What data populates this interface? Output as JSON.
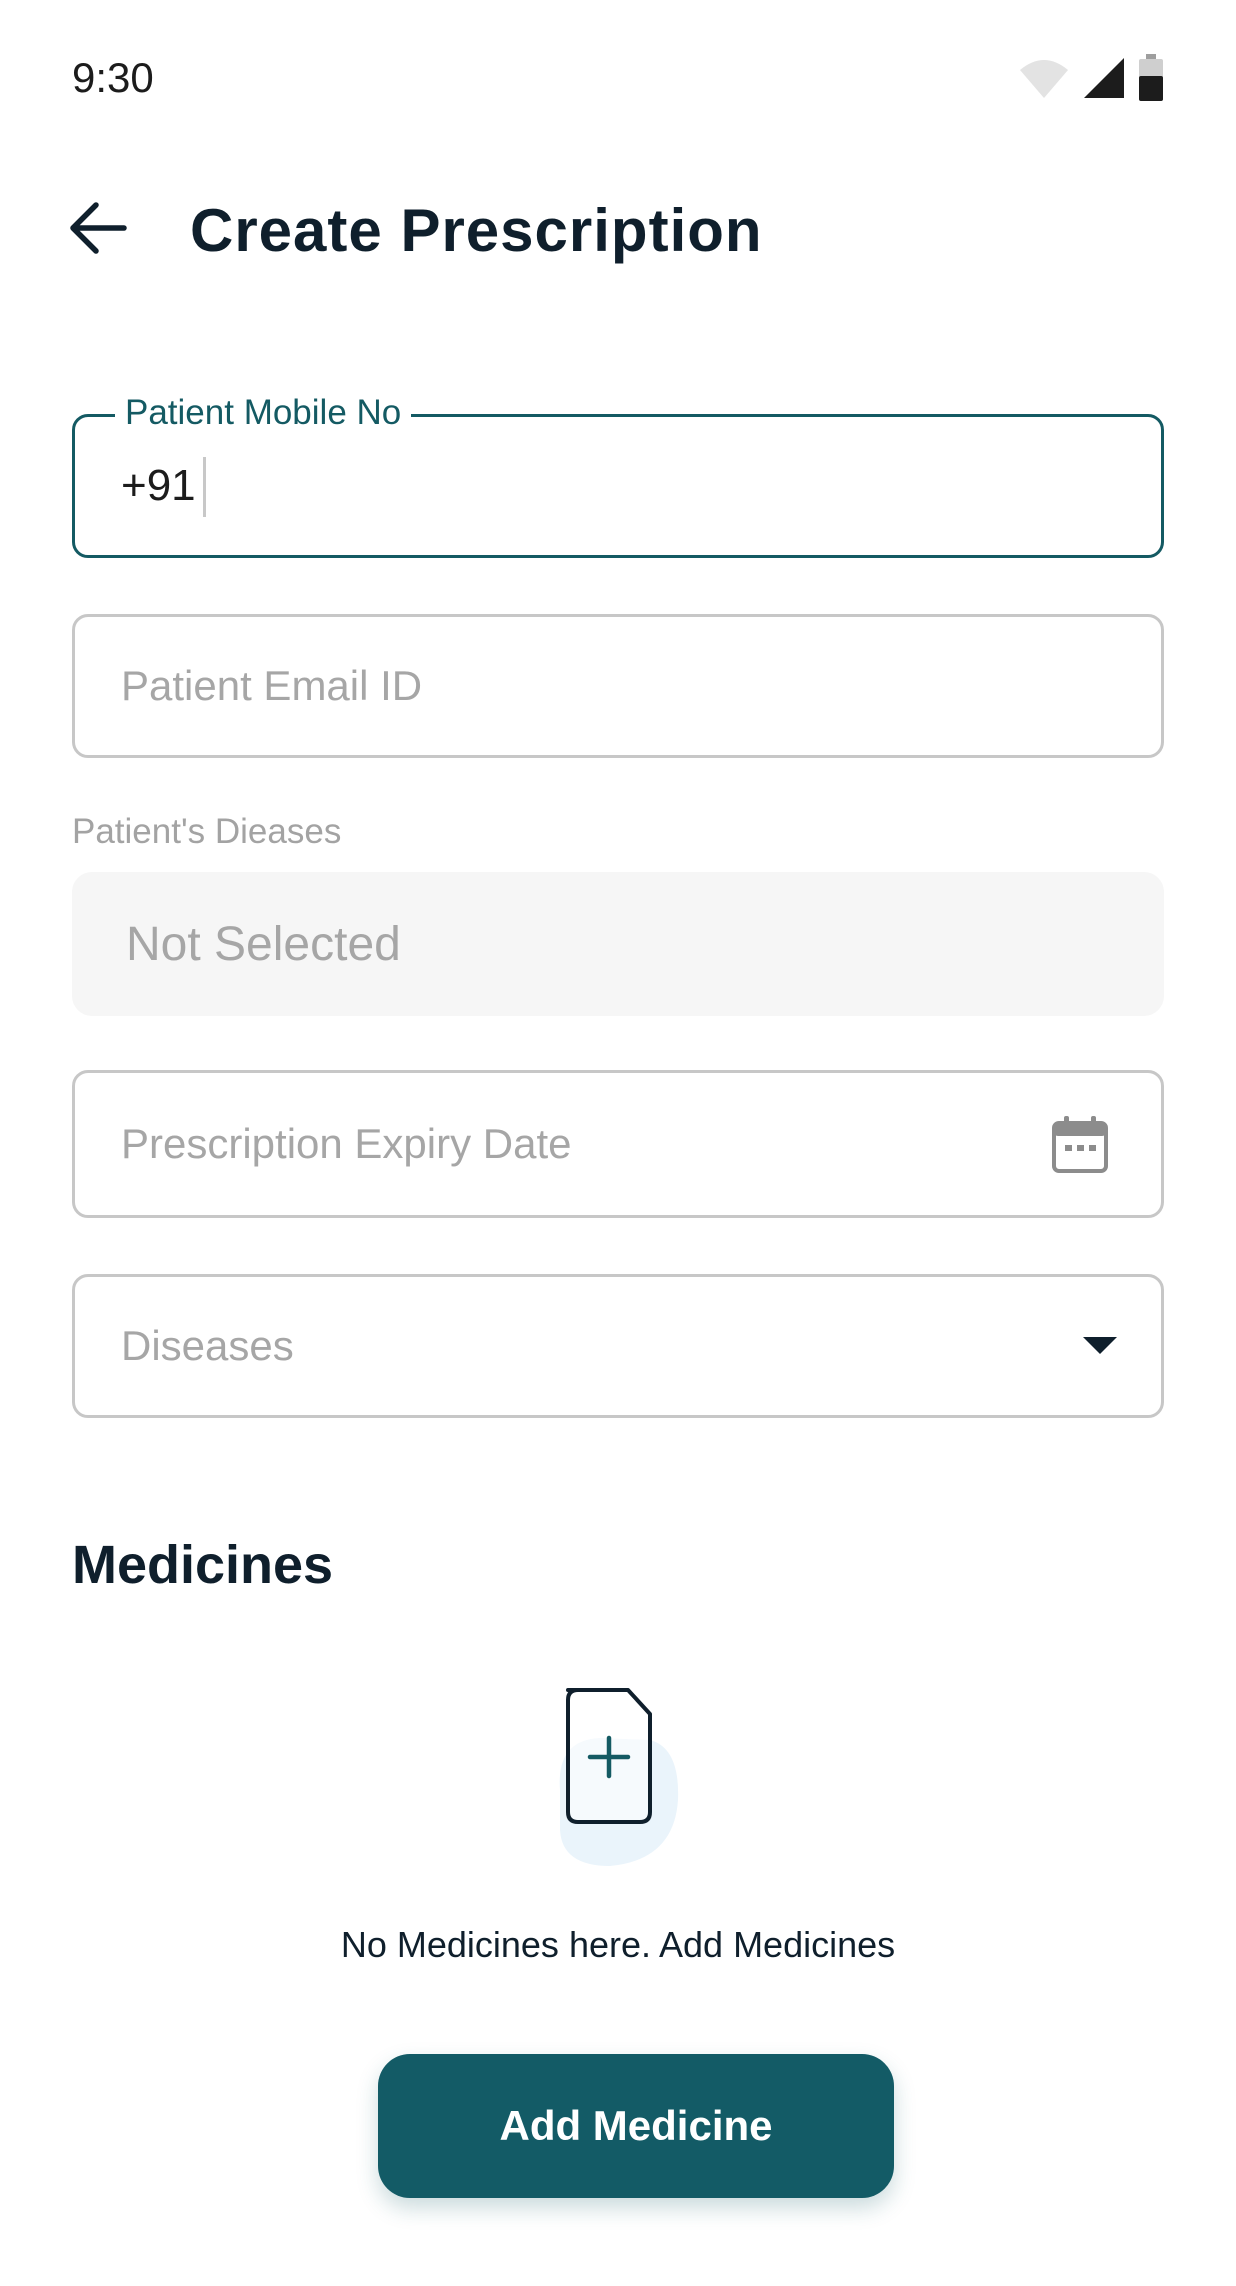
{
  "status_bar": {
    "time": "9:30",
    "icons": [
      "wifi-icon",
      "signal-icon",
      "battery-icon"
    ]
  },
  "header": {
    "back_icon": "arrow-left-icon",
    "title": "Create Prescription"
  },
  "form": {
    "mobile": {
      "label": "Patient Mobile No",
      "prefix": "+91",
      "value": ""
    },
    "email": {
      "placeholder": "Patient Email ID",
      "value": ""
    },
    "diseases_section": {
      "caption": "Patient's Dieases",
      "value": "Not Selected"
    },
    "expiry": {
      "placeholder": "Prescription Expiry Date",
      "icon": "calendar-icon"
    },
    "diseases_dropdown": {
      "placeholder": "Diseases",
      "icon": "caret-down-icon"
    }
  },
  "medicines": {
    "heading": "Medicines",
    "empty_icon": "add-document-icon",
    "empty_text": "No Medicines here. Add Medicines",
    "add_button_label": "Add Medicine"
  },
  "colors": {
    "primary": "#135b66",
    "text": "#0f1f2c",
    "placeholder": "#a6a6a6",
    "border": "#c7c7c7",
    "filled_bg": "#f6f6f6",
    "illustration_blob": "#eaf4fb"
  }
}
